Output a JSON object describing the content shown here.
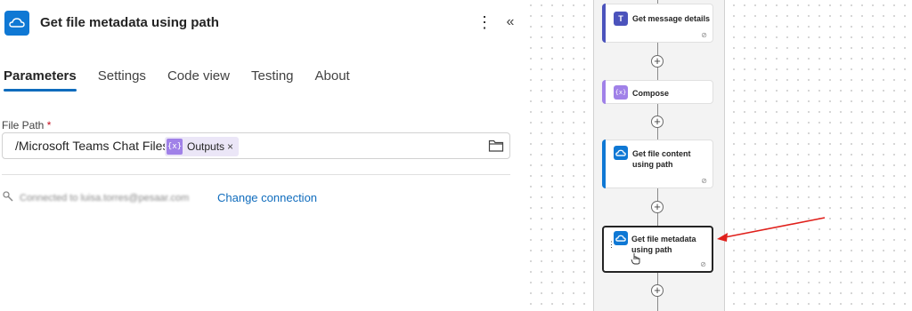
{
  "panel": {
    "title": "Get file metadata using path",
    "more_icon": "more-vertical-icon",
    "collapse_icon": "double-chevron-left-icon",
    "tabs": [
      {
        "label": "Parameters",
        "active": true
      },
      {
        "label": "Settings",
        "active": false
      },
      {
        "label": "Code view",
        "active": false
      },
      {
        "label": "Testing",
        "active": false
      },
      {
        "label": "About",
        "active": false
      }
    ],
    "file_path": {
      "label": "File Path",
      "required_mark": "*",
      "value_text": "/Microsoft Teams Chat Files/",
      "token": {
        "icon": "{x}",
        "label": "Outputs",
        "remove": "×"
      }
    },
    "connection": {
      "text": "Connected to luisa.torres@pesaar.com",
      "change_label": "Change connection"
    }
  },
  "flow": {
    "cards": [
      {
        "label": "Get message details",
        "icon": "teams-icon",
        "color": "#4b53bc"
      },
      {
        "label": "Compose",
        "icon": "compose-icon",
        "color": "#a081e8"
      },
      {
        "label": "Get file content using path",
        "icon": "onedrive-icon",
        "color": "#0f78d4"
      },
      {
        "label": "Get file metadata using path",
        "icon": "onedrive-icon",
        "color": "#0f78d4",
        "selected": true
      }
    ]
  },
  "colors": {
    "accent": "#0f6cbd",
    "arrow": "#e0201b",
    "required": "#c50f1f"
  }
}
